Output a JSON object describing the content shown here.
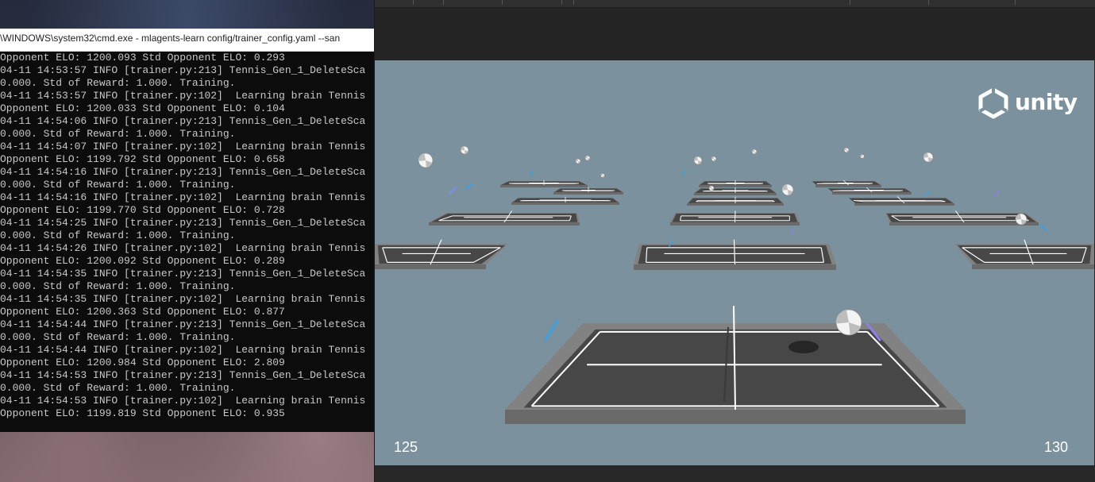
{
  "console": {
    "title": "\\WINDOWS\\system32\\cmd.exe - mlagents-learn  config/trainer_config.yaml --san",
    "lines": [
      "Opponent ELO: 1200.093 Std Opponent ELO: 0.293",
      "04-11 14:53:57 INFO [trainer.py:213] Tennis_Gen_1_DeleteSca",
      "0.000. Std of Reward: 1.000. Training.",
      "04-11 14:53:57 INFO [trainer.py:102]  Learning brain Tennis",
      "Opponent ELO: 1200.033 Std Opponent ELO: 0.104",
      "04-11 14:54:06 INFO [trainer.py:213] Tennis_Gen_1_DeleteSca",
      "0.000. Std of Reward: 1.000. Training.",
      "04-11 14:54:07 INFO [trainer.py:102]  Learning brain Tennis",
      "Opponent ELO: 1199.792 Std Opponent ELO: 0.658",
      "04-11 14:54:16 INFO [trainer.py:213] Tennis_Gen_1_DeleteSca",
      "0.000. Std of Reward: 1.000. Training.",
      "04-11 14:54:16 INFO [trainer.py:102]  Learning brain Tennis",
      "Opponent ELO: 1199.770 Std Opponent ELO: 0.728",
      "04-11 14:54:25 INFO [trainer.py:213] Tennis_Gen_1_DeleteSca",
      "0.000. Std of Reward: 1.000. Training.",
      "04-11 14:54:26 INFO [trainer.py:102]  Learning brain Tennis",
      "Opponent ELO: 1200.092 Std Opponent ELO: 0.289",
      "04-11 14:54:35 INFO [trainer.py:213] Tennis_Gen_1_DeleteSca",
      "0.000. Std of Reward: 1.000. Training.",
      "04-11 14:54:35 INFO [trainer.py:102]  Learning brain Tennis",
      "Opponent ELO: 1200.363 Std Opponent ELO: 0.877",
      "04-11 14:54:44 INFO [trainer.py:213] Tennis_Gen_1_DeleteSca",
      "0.000. Std of Reward: 1.000. Training.",
      "04-11 14:54:44 INFO [trainer.py:102]  Learning brain Tennis",
      "Opponent ELO: 1200.984 Std Opponent ELO: 2.809",
      "04-11 14:54:53 INFO [trainer.py:213] Tennis_Gen_1_DeleteSca",
      "0.000. Std of Reward: 1.000. Training.",
      "04-11 14:54:53 INFO [trainer.py:102]  Learning brain Tennis",
      "Opponent ELO: 1199.819 Std Opponent ELO: 0.935"
    ]
  },
  "game": {
    "logo_text": "unity",
    "score_left": "125",
    "score_right": "130",
    "background_color": "#7b929e",
    "court_color": "#474747",
    "racket_color": "#3aa0e6",
    "icons": [
      "unity-logo-icon",
      "tennis-ball-icon",
      "tennis-racket-icon"
    ]
  }
}
